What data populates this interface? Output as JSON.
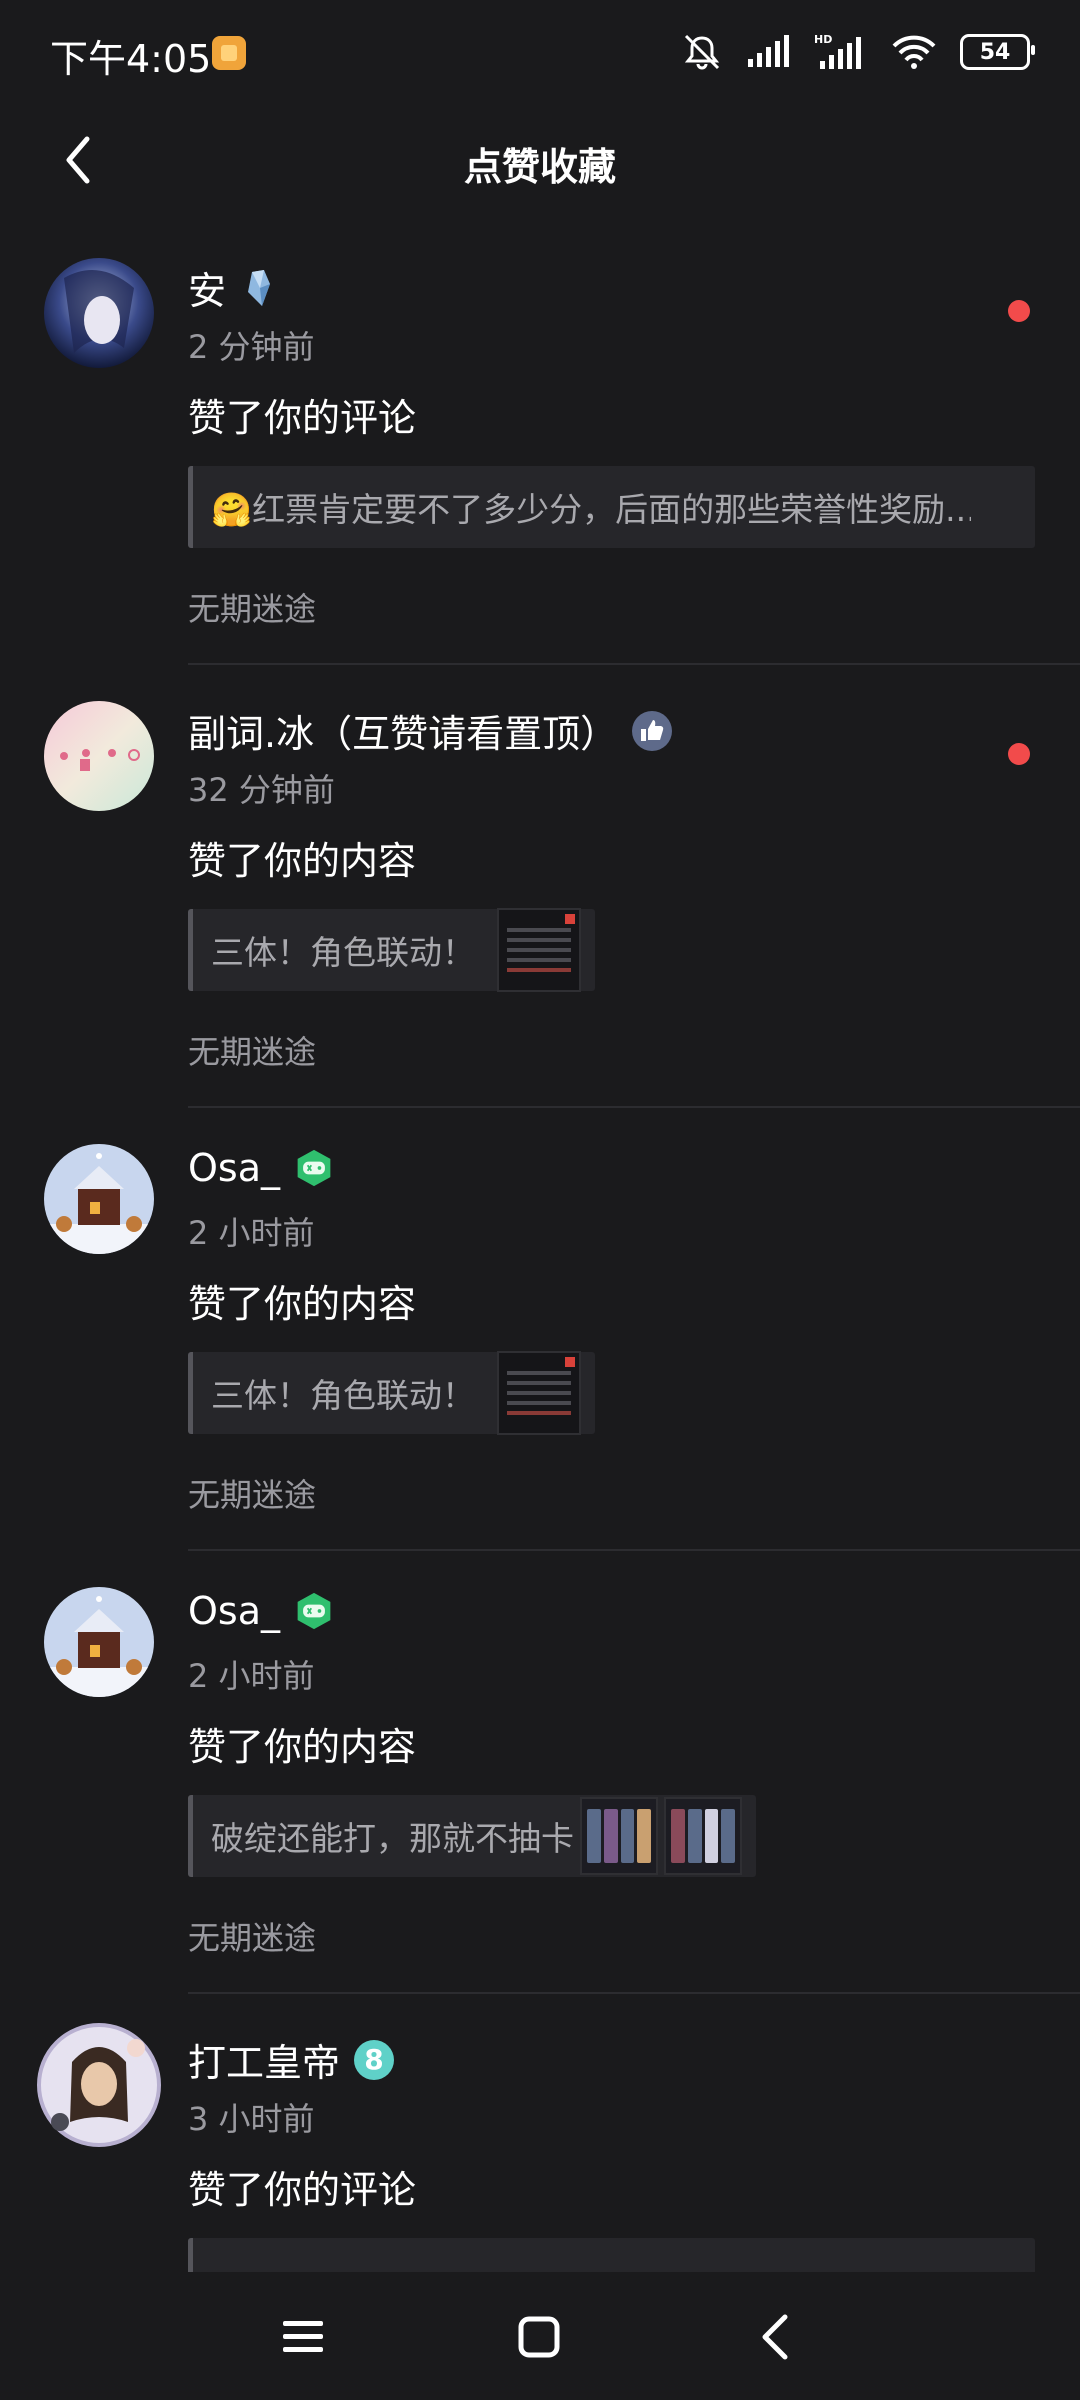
{
  "status_bar": {
    "time": "下午4:05",
    "battery": "54",
    "icons": [
      "app-notification-icon",
      "mute-icon",
      "signal-icon",
      "hd-signal-icon",
      "wifi-icon",
      "battery-icon"
    ]
  },
  "header": {
    "title": "点赞收藏",
    "back_icon": "chevron-left-icon"
  },
  "colors": {
    "background": "#1a1a1c",
    "secondary_text": "#9a9aa0",
    "unread_dot": "#f24b4b",
    "quote_bg": "#26262a"
  },
  "notifications": [
    {
      "username": "安",
      "badge": "crystal-badge-icon",
      "time": "2 分钟前",
      "action": "赞了你的评论",
      "quote": "🤗红票肯定要不了多少分，后面的那些荣誉性奖励...",
      "source": "无期迷途",
      "unread": true
    },
    {
      "username": "副词.冰（互赞请看置顶）",
      "badge": "thumbs-up-badge-icon",
      "time": "32 分钟前",
      "action": "赞了你的内容",
      "quote": "三体！角色联动！",
      "source": "无期迷途",
      "unread": true
    },
    {
      "username": "Osa_",
      "badge": "gamepad-badge-icon",
      "time": "2 小时前",
      "action": "赞了你的内容",
      "quote": "三体！角色联动！",
      "source": "无期迷途",
      "unread": false
    },
    {
      "username": "Osa_",
      "badge": "gamepad-badge-icon",
      "time": "2 小时前",
      "action": "赞了你的内容",
      "quote": "破绽还能打，那就不抽卡",
      "source": "无期迷途",
      "unread": false
    },
    {
      "username": "打工皇帝",
      "badge": "level-8-badge-icon",
      "badge_text": "8",
      "time": "3 小时前",
      "action": "赞了你的评论",
      "quote": "",
      "source": "",
      "unread": false
    }
  ],
  "nav": {
    "menu_icon": "menu-icon",
    "home_icon": "home-square-icon",
    "back_icon": "back-triangle-icon"
  }
}
